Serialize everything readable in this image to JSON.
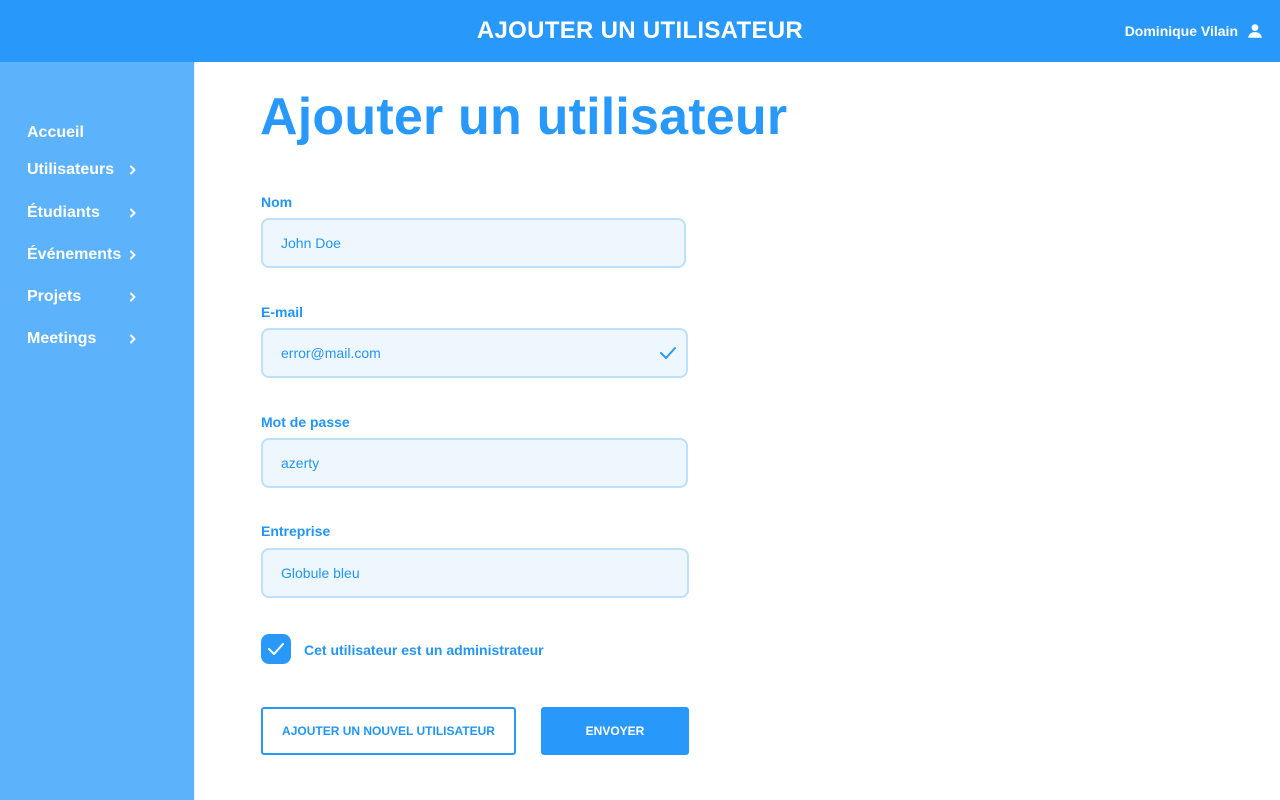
{
  "header": {
    "title": "AJOUTER UN UTILISATEUR",
    "user_name": "Dominique Vilain",
    "user_icon": "user-icon"
  },
  "sidebar": {
    "items": [
      {
        "label": "Accueil",
        "has_chevron": false
      },
      {
        "label": "Utilisateurs",
        "has_chevron": true
      },
      {
        "label": "Étudiants",
        "has_chevron": true
      },
      {
        "label": "Événements",
        "has_chevron": true
      },
      {
        "label": "Projets",
        "has_chevron": true
      },
      {
        "label": "Meetings",
        "has_chevron": true
      }
    ]
  },
  "main": {
    "page_title": "Ajouter un utilisateur",
    "form": {
      "name": {
        "label": "Nom",
        "value": "John Doe"
      },
      "email": {
        "label": "E-mail",
        "value": "error@mail.com",
        "valid_icon": "check-icon"
      },
      "password": {
        "label": "Mot de passe",
        "value": "azerty"
      },
      "company": {
        "label": "Entreprise",
        "value": "Globule bleu"
      },
      "admin": {
        "label": "Cet utilisateur est un administrateur",
        "checked": true
      },
      "add_new_label": "AJOUTER UN NOUVEL UTILISATEUR",
      "submit_label": "ENVOYER"
    }
  },
  "colors": {
    "primary": "#2899fb",
    "sidebar": "#5db3fb",
    "field_bg": "#eef7fe",
    "field_border": "#bde0fb"
  }
}
